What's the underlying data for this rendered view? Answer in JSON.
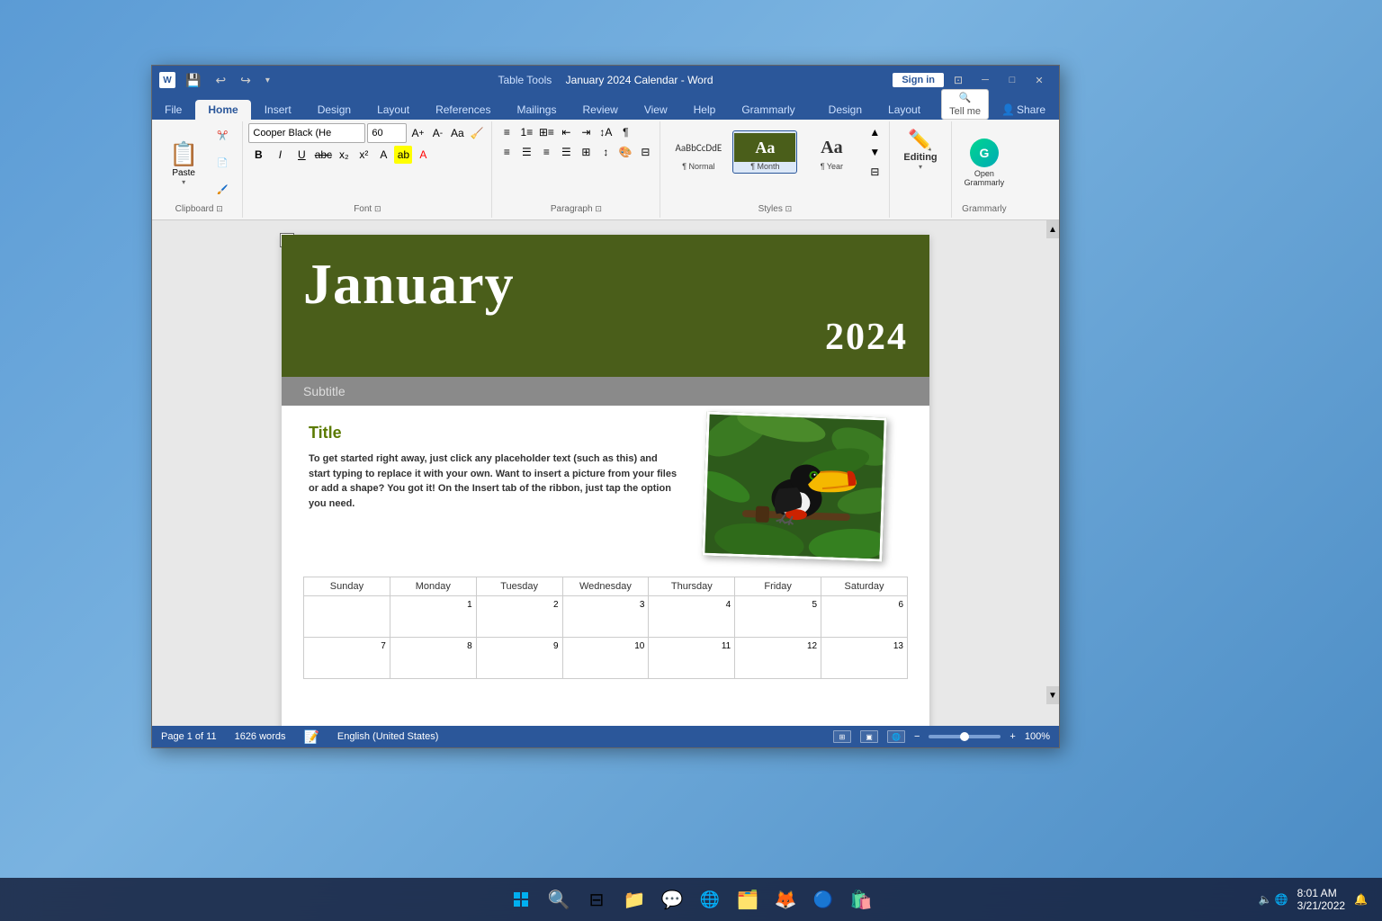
{
  "window": {
    "title": "January 2024 Calendar - Word",
    "table_tools": "Table Tools",
    "sign_in": "Sign in"
  },
  "titlebar": {
    "minimize": "─",
    "maximize": "□",
    "close": "✕",
    "quick_access": [
      "💾",
      "↩",
      "↪",
      "▼"
    ]
  },
  "tabs": {
    "items": [
      "File",
      "Home",
      "Insert",
      "Design",
      "Layout",
      "References",
      "Mailings",
      "Review",
      "View",
      "Help",
      "Grammarly",
      "Design",
      "Layout"
    ],
    "active": "Home",
    "table_tools_tabs": [
      "Design",
      "Layout"
    ]
  },
  "ribbon": {
    "clipboard": {
      "label": "Clipboard",
      "paste": "Paste"
    },
    "font": {
      "label": "Font",
      "family": "Cooper Black (He",
      "size": "60",
      "bold": "B",
      "italic": "I",
      "underline": "U"
    },
    "paragraph": {
      "label": "Paragraph"
    },
    "styles": {
      "label": "Styles",
      "items": [
        {
          "id": "normal",
          "label": "¶ Normal",
          "preview": "AaBbCcDdE"
        },
        {
          "id": "month",
          "label": "¶ Month",
          "preview": "Aa",
          "active": true
        },
        {
          "id": "year",
          "label": "¶ Year",
          "preview": "Aa"
        }
      ]
    },
    "editing": {
      "label": "Editing",
      "icon": "✏️"
    },
    "grammarly": {
      "open_label": "Open\nGrammarly",
      "label": "Grammarly"
    },
    "tell_me": {
      "placeholder": "Tell me"
    }
  },
  "document": {
    "month": "January",
    "year": "2024",
    "subtitle": "Subtitle",
    "content_title": "Title",
    "body_text": "To get started right away, just click any placeholder text (such as this) and\nstart typing to replace it with your own. Want to insert a picture from your files\nor add a shape? You got it! On the Insert tab of the ribbon, just tap the option\nyou need.",
    "calendar": {
      "headers": [
        "Sunday",
        "Monday",
        "Tuesday",
        "Wednesday",
        "Thursday",
        "Friday",
        "Saturday"
      ],
      "rows": [
        [
          "",
          "1",
          "2",
          "3",
          "4",
          "5",
          "6"
        ],
        [
          "7",
          "8",
          "9",
          "10",
          "11",
          "12",
          "13"
        ]
      ]
    }
  },
  "status_bar": {
    "page": "Page 1 of 11",
    "words": "1626 words",
    "language": "English (United States)",
    "zoom": "100%"
  },
  "taskbar": {
    "time": "8:01 AM",
    "date": "3/21/2022",
    "icons": [
      "⊞",
      "🔍",
      "📁",
      "💬",
      "🌐",
      "📁",
      "🦊",
      "🔵"
    ]
  }
}
